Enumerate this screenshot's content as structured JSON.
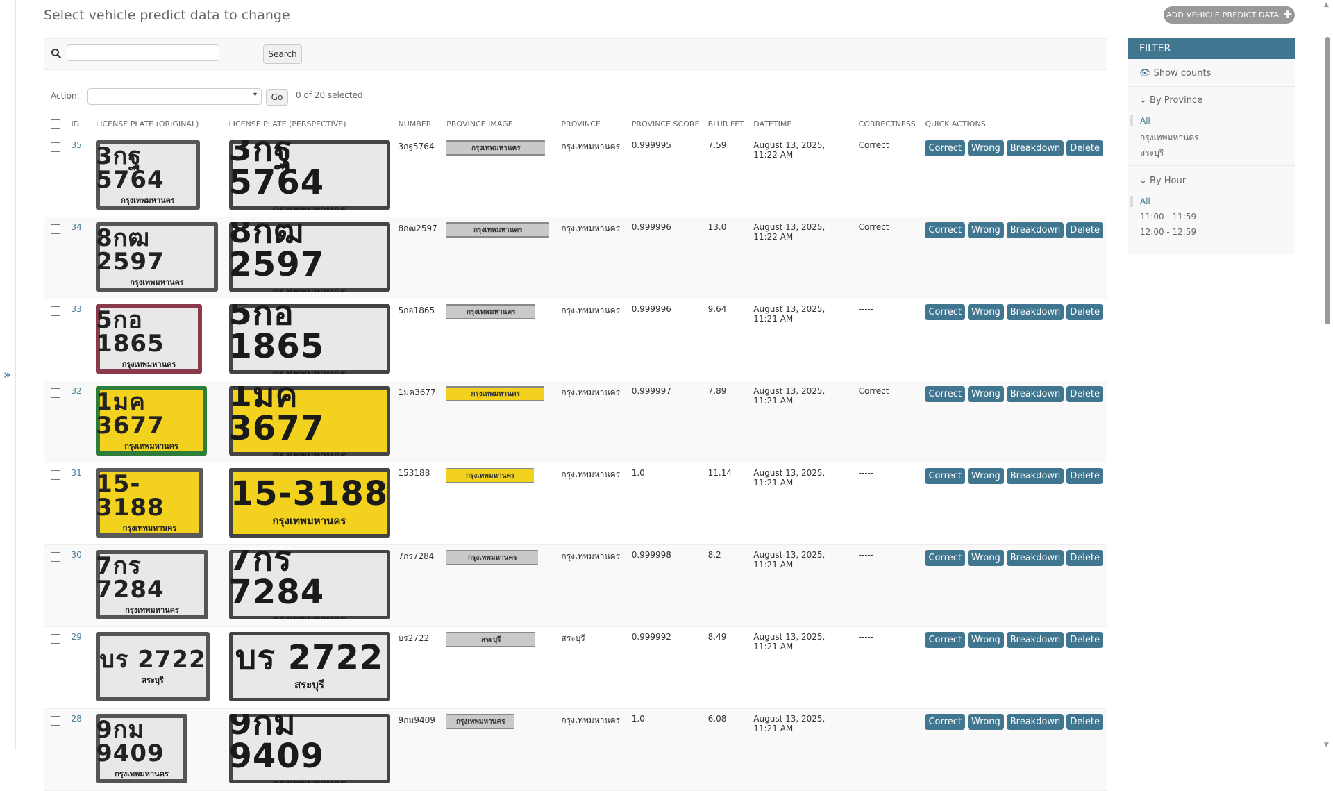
{
  "page": {
    "title": "Select vehicle predict data to change",
    "add_button": "ADD VEHICLE PREDICT DATA",
    "search_button": "Search",
    "search_value": "",
    "action_label": "Action:",
    "action_selected": "---------",
    "go_button": "Go",
    "selection_count": "0 of 20 selected",
    "sidebar_toggle": "»"
  },
  "columns": [
    "ID",
    "LICENSE PLATE (ORIGINAL)",
    "LICENSE PLATE (PERSPECTIVE)",
    "NUMBER",
    "PROVINCE IMAGE",
    "PROVINCE",
    "PROVINCE SCORE",
    "BLUR FFT",
    "DATETIME",
    "CORRECTNESS",
    "QUICK ACTIONS"
  ],
  "quick_actions": [
    "Correct",
    "Wrong",
    "Breakdown",
    "Delete"
  ],
  "rows": [
    {
      "id": "35",
      "plate_text": "3กฐ 5764",
      "number": "3กฐ5764",
      "province_img_text": "กรุงเทพมหานคร",
      "province": "กรุงเทพมหานคร",
      "score": "0.999995",
      "blur": "7.59",
      "datetime": "August 13, 2025, 11:22 AM",
      "correctness": "Correct",
      "plate_style": "white"
    },
    {
      "id": "34",
      "plate_text": "8กฒ 2597",
      "number": "8กฒ2597",
      "province_img_text": "กรุงเทพมหานคร",
      "province": "กรุงเทพมหานคร",
      "score": "0.999996",
      "blur": "13.0",
      "datetime": "August 13, 2025, 11:22 AM",
      "correctness": "Correct",
      "plate_style": "white"
    },
    {
      "id": "33",
      "plate_text": "5กอ 1865",
      "number": "5กอ1865",
      "province_img_text": "กรุงเทพมหานคร",
      "province": "กรุงเทพมหานคร",
      "score": "0.999996",
      "blur": "9.64",
      "datetime": "August 13, 2025, 11:21 AM",
      "correctness": "-----",
      "plate_style": "white"
    },
    {
      "id": "32",
      "plate_text": "1มค 3677",
      "number": "1มค3677",
      "province_img_text": "กรุงเทพมหานคร",
      "province": "กรุงเทพมหานคร",
      "score": "0.999997",
      "blur": "7.89",
      "datetime": "August 13, 2025, 11:21 AM",
      "correctness": "Correct",
      "plate_style": "yellow"
    },
    {
      "id": "31",
      "plate_text": "15-3188",
      "number": "153188",
      "province_img_text": "กรุงเทพมหานคร",
      "province": "กรุงเทพมหานคร",
      "score": "1.0",
      "blur": "11.14",
      "datetime": "August 13, 2025, 11:21 AM",
      "correctness": "-----",
      "plate_style": "yellow"
    },
    {
      "id": "30",
      "plate_text": "7กร 7284",
      "number": "7กร7284",
      "province_img_text": "กรุงเทพมหานคร",
      "province": "กรุงเทพมหานคร",
      "score": "0.999998",
      "blur": "8.2",
      "datetime": "August 13, 2025, 11:21 AM",
      "correctness": "-----",
      "plate_style": "white"
    },
    {
      "id": "29",
      "plate_text": "บร 2722",
      "number": "บร2722",
      "province_img_text": "สระบุรี",
      "province": "สระบุรี",
      "score": "0.999992",
      "blur": "8.49",
      "datetime": "August 13, 2025, 11:21 AM",
      "correctness": "-----",
      "plate_style": "white"
    },
    {
      "id": "28",
      "plate_text": "9กม 9409",
      "number": "9กม9409",
      "province_img_text": "กรุงเทพมหานคร",
      "province": "กรุงเทพมหานคร",
      "score": "1.0",
      "blur": "6.08",
      "datetime": "August 13, 2025, 11:21 AM",
      "correctness": "-----",
      "plate_style": "white"
    }
  ],
  "filter": {
    "title": "FILTER",
    "show_counts": "Show counts",
    "sections": [
      {
        "title": "↓ By Province",
        "options": [
          "All",
          "กรุงเทพมหานคร",
          "สระบุรี"
        ]
      },
      {
        "title": "↓ By Hour",
        "options": [
          "All",
          "11:00 - 11:59",
          "12:00 - 12:59"
        ]
      }
    ]
  },
  "colors": {
    "primary": "#417690",
    "link": "#447e9b",
    "muted_button": "#999999",
    "plate_white": "#e8e8e8",
    "plate_yellow": "#f2d21f"
  },
  "icons": [
    "search-icon",
    "plus-icon",
    "eye-icon",
    "chevron-double-right-icon"
  ]
}
